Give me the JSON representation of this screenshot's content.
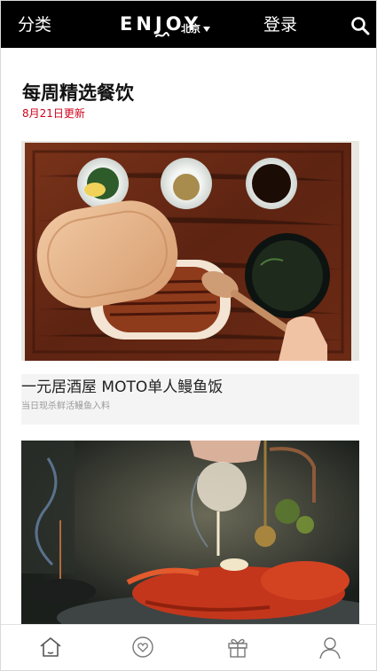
{
  "header": {
    "category_label": "分类",
    "logo_text": "ENJOY",
    "city": "北京",
    "login_label": "登录"
  },
  "section": {
    "title": "每周精选餐饮",
    "updated": "8月21日更新"
  },
  "cards": [
    {
      "title": "一元居酒屋 MOTO单人鳗鱼饭",
      "subtitle": "当日现杀鲜活鳗鱼入料"
    }
  ],
  "icons": {
    "search": "search-icon",
    "tabs": [
      "home-icon",
      "heart-icon",
      "gift-icon",
      "user-icon"
    ]
  },
  "colors": {
    "header_bg": "#000000",
    "accent_red": "#d0021b",
    "card_info_bg": "#f4f4f4"
  }
}
